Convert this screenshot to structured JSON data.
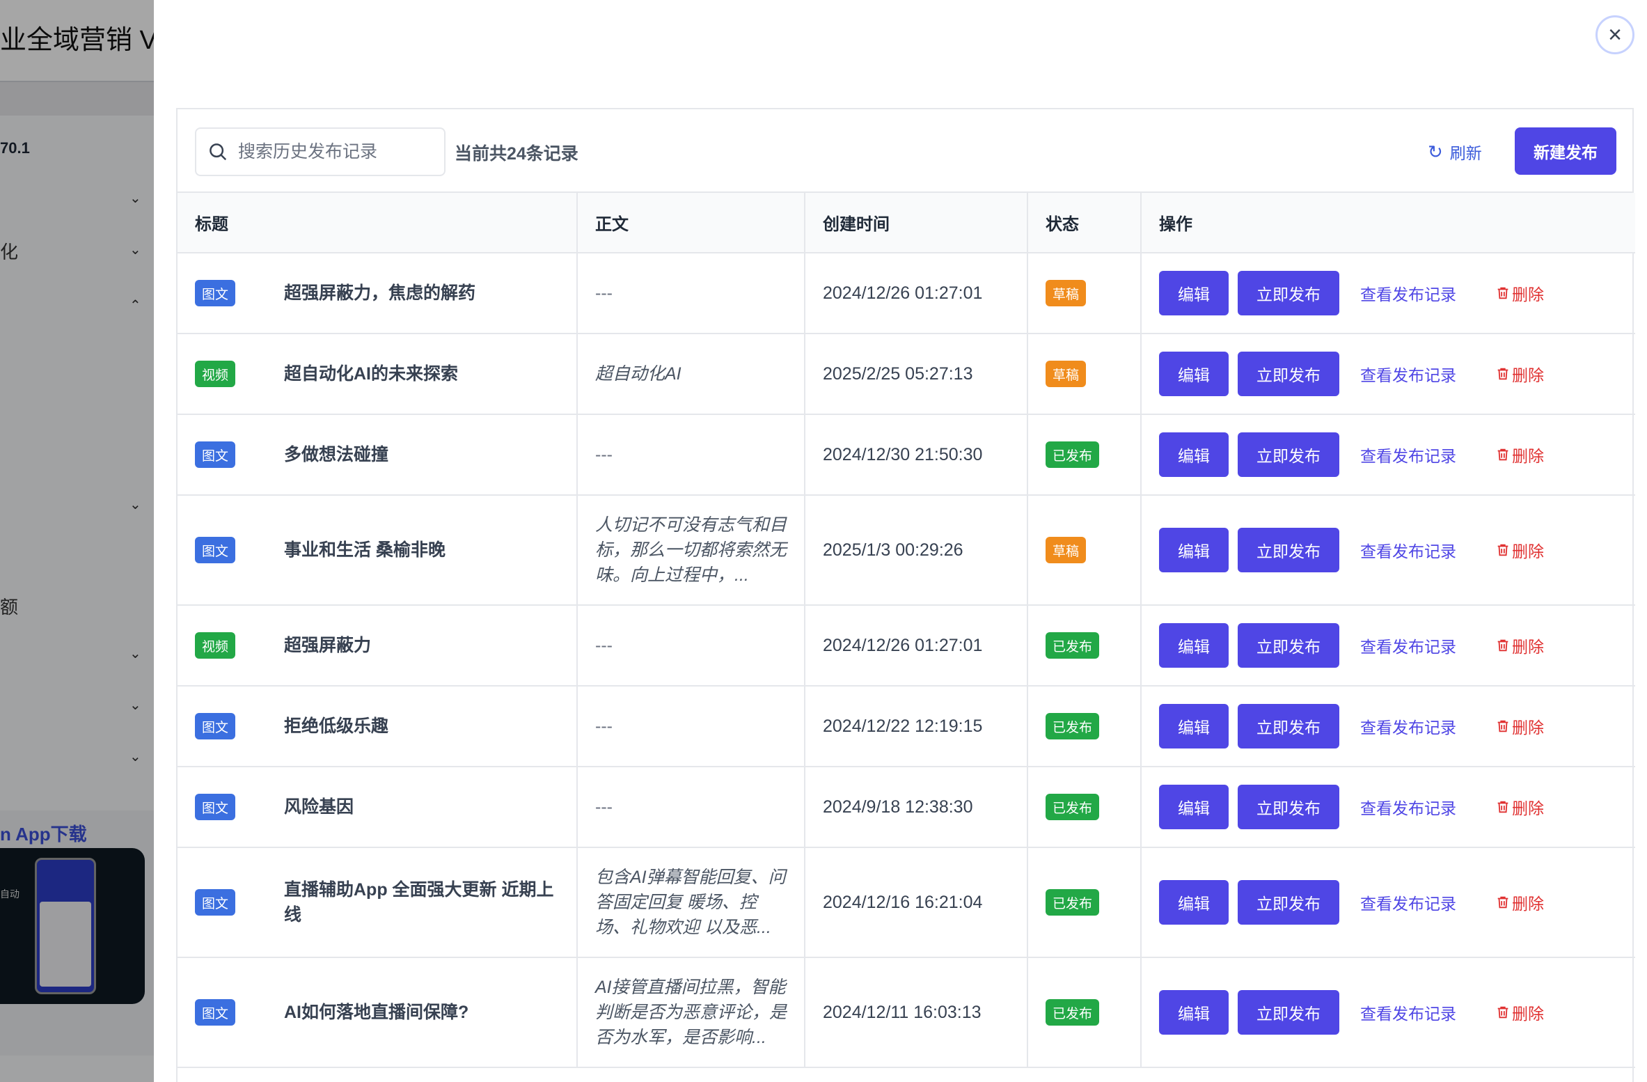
{
  "background": {
    "app_title": "业全域营销 V(",
    "version": "70.1",
    "sidebar_texts": [
      "化",
      "额"
    ],
    "app_download_label": "n App下载",
    "phone_caption": "自动"
  },
  "toolbar": {
    "search_placeholder": "搜索历史发布记录",
    "record_count": "当前共24条记录",
    "refresh_label": "刷新",
    "new_publish_label": "新建发布"
  },
  "table": {
    "headers": [
      "标题",
      "正文",
      "创建时间",
      "状态",
      "操作"
    ],
    "rows": [
      {
        "type": "图文",
        "title": "超强屏蔽力，焦虑的解药",
        "body": "---",
        "time": "2024/12/26 01:27:01",
        "status": "草稿"
      },
      {
        "type": "视频",
        "title": "超自动化AI的未来探索",
        "body": "超自动化AI",
        "time": "2025/2/25 05:27:13",
        "status": "草稿"
      },
      {
        "type": "图文",
        "title": "多做想法碰撞",
        "body": "---",
        "time": "2024/12/30 21:50:30",
        "status": "已发布"
      },
      {
        "type": "图文",
        "title": "事业和生活 桑榆非晚",
        "body": "人切记不可没有志气和目标，那么一切都将索然无味。向上过程中，...",
        "time": "2025/1/3 00:29:26",
        "status": "草稿"
      },
      {
        "type": "视频",
        "title": "超强屏蔽力",
        "body": "---",
        "time": "2024/12/26 01:27:01",
        "status": "已发布"
      },
      {
        "type": "图文",
        "title": "拒绝低级乐趣",
        "body": "---",
        "time": "2024/12/22 12:19:15",
        "status": "已发布"
      },
      {
        "type": "图文",
        "title": "风险基因",
        "body": "---",
        "time": "2024/9/18 12:38:30",
        "status": "已发布"
      },
      {
        "type": "图文",
        "title": "直播辅助App 全面强大更新 近期上线",
        "body": "包含AI弹幕智能回复、问答固定回复 暖场、控场、礼物欢迎 以及恶...",
        "time": "2024/12/16 16:21:04",
        "status": "已发布"
      },
      {
        "type": "图文",
        "title": "AI如何落地直播间保障?",
        "body": "AI接管直播间拉黑，智能判断是否为恶意评论，是否为水军，是否影响...",
        "time": "2024/12/11 16:03:13",
        "status": "已发布"
      }
    ]
  },
  "ops": {
    "edit_label": "编辑",
    "publish_label": "立即发布",
    "history_label": "查看发布记录",
    "delete_label": "删除"
  },
  "colors": {
    "primary": "#4f46e5",
    "draft": "#f08c1c",
    "published": "#22a846",
    "image_type": "#3b6fe0",
    "video_type": "#22a846",
    "danger": "#e03131"
  }
}
